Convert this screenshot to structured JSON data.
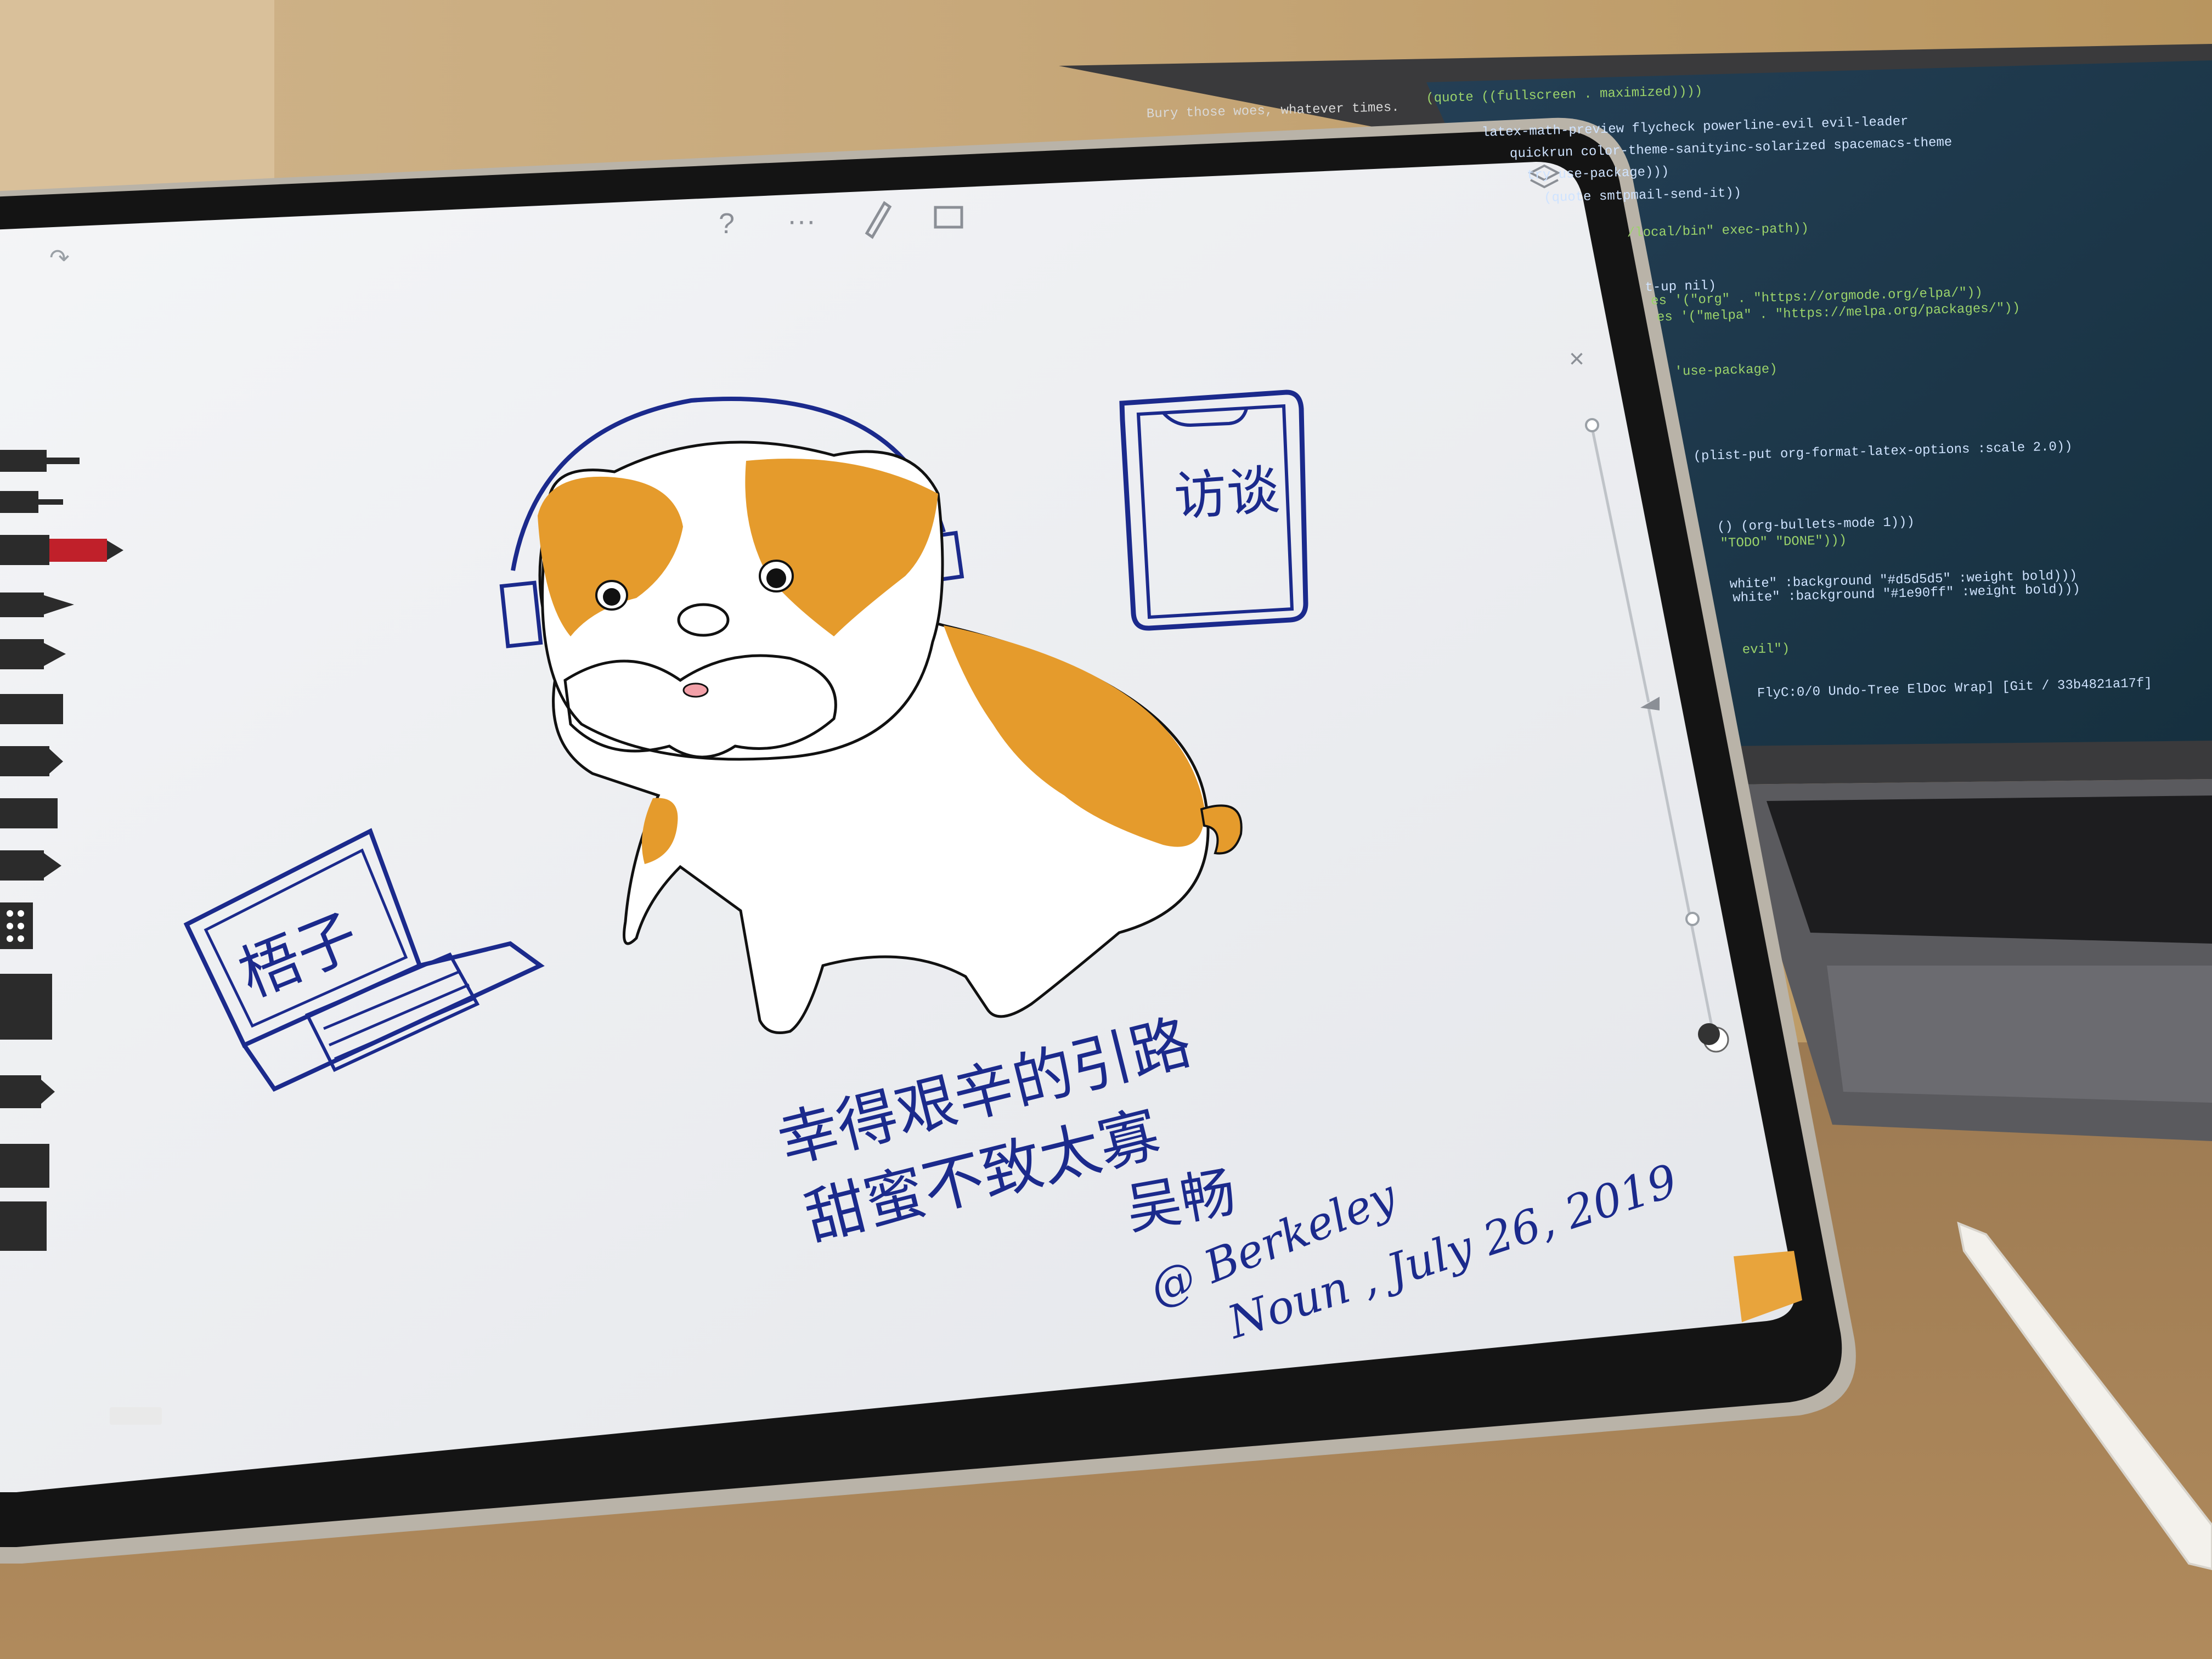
{
  "photo": {
    "subject": "",
    "colors": {
      "wall": "#c9ab7e",
      "desk": "#a8835a",
      "ipad_bezel": "#141414",
      "screen": "#eef0f3",
      "ink_blue": "#1b2a8c",
      "dog_orange": "#e59b2c",
      "laptop_screen": "#1e3a4f"
    }
  },
  "ipad": {
    "toolbar": {
      "help_icon": "question-icon",
      "more_icon": "ellipsis-icon",
      "pen_icon": "pen-icon",
      "note_icon": "sticky-note-icon",
      "layers_icon": "layers-icon",
      "close_icon": "close-icon"
    },
    "drawing": {
      "phone_label": "访谈",
      "laptop_label": "梧子",
      "poem_line_1": "幸得艰辛的引路",
      "poem_line_2": "甜蜜不致太寡",
      "author": "吴畅",
      "location": "@ Berkeley",
      "date": "Noun , July 26, 2019"
    }
  },
  "laptop_code": [
    "Bury those woes, whatever times.",
    "(quote ((fullscreen . maximized))))",
    "latex-math-preview flycheck powerline-evil evil-leader",
    "quickrun color-theme-sanityinc-solarized spacemacs-theme",
    "try use-package)))",
    "(quote smtpmail-send-it))",
    "/local/bin\" exec-path))",
    "t-up nil)",
    "es '(\"org\" . \"https://orgmode.org/elpa/\"))",
    "es '(\"melpa\" . \"https://melpa.org/packages/\"))",
    "'use-package)",
    "(plist-put org-format-latex-options :scale 2.0))",
    "() (org-bullets-mode 1)))",
    "\"TODO\" \"DONE\")))",
    "white\" :background \"#d5d5d5\" :weight bold)))",
    "white\" :background \"#1e90ff\" :weight bold)))",
    "evil\")",
    "FlyC:0/0 Undo-Tree ElDoc Wrap] [Git / 33b4821a17f]"
  ]
}
